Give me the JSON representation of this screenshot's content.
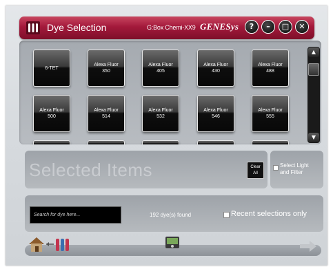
{
  "titlebar": {
    "title": "Dye Selection",
    "device": "G:Box Chemi-XX9",
    "brand": "GENESys",
    "buttons": [
      "?",
      "–",
      "□",
      "✕"
    ]
  },
  "dyes": [
    {
      "line1": "6-TET",
      "line2": ""
    },
    {
      "line1": "Alexa Fluor",
      "line2": "350"
    },
    {
      "line1": "Alexa Fluor",
      "line2": "405"
    },
    {
      "line1": "Alexa Fluor",
      "line2": "430"
    },
    {
      "line1": "Alexa Fluor",
      "line2": "488"
    },
    {
      "line1": "Alexa Fluor",
      "line2": "500"
    },
    {
      "line1": "Alexa Fluor",
      "line2": "514"
    },
    {
      "line1": "Alexa Fluor",
      "line2": "532"
    },
    {
      "line1": "Alexa Fluor",
      "line2": "546"
    },
    {
      "line1": "Alexa Fluor",
      "line2": "555"
    }
  ],
  "scroll": {
    "up": "▲",
    "down": "▼"
  },
  "selected": {
    "title": "Selected Items",
    "clear_line1": "Clear",
    "clear_line2": "All"
  },
  "light": {
    "line1": "Select Light",
    "line2": "and Filter"
  },
  "search": {
    "placeholder": "Search for dye here...",
    "found": "192 dye(s) found",
    "recent_label": "Recent selections only"
  },
  "nav": {
    "home_icon": "home-icon",
    "camera_icon": "camera-icon",
    "next_icon": "arrow-right-icon"
  },
  "colors": {
    "titlebar": "#a3193b",
    "panel": "#aeb2b7",
    "tile": "#0e0e0e"
  }
}
